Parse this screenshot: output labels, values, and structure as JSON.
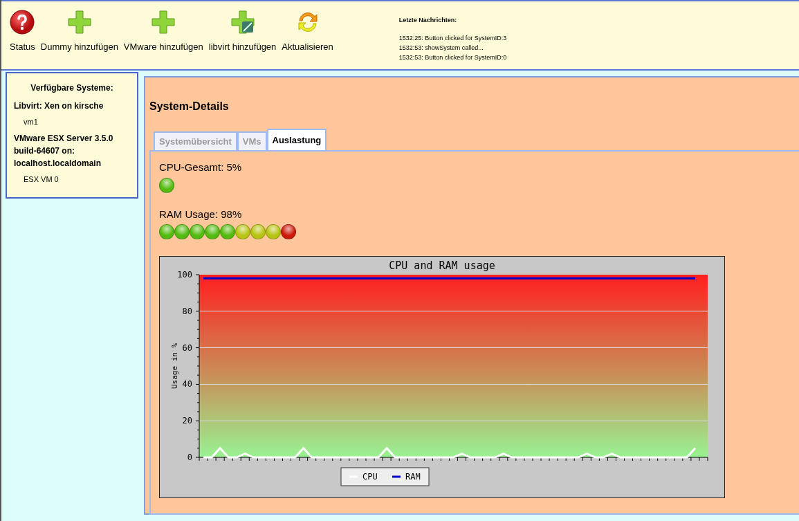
{
  "toolbar": {
    "buttons": [
      {
        "kind": "status",
        "label": "Status"
      },
      {
        "kind": "add",
        "label": "Dummy hinzufügen"
      },
      {
        "kind": "add",
        "label": "VMware hinzufügen"
      },
      {
        "kind": "add-libvirt",
        "label": "libvirt hinzufügen"
      },
      {
        "kind": "refresh",
        "label": "Aktualisieren"
      }
    ],
    "messages": {
      "title": "Letzte Nachrichten:",
      "lines": [
        "1532:25: Button clicked for SystemID:3",
        "1532:53: showSystem called...",
        "1532:53: Button clicked for SystemID:0"
      ]
    }
  },
  "sidebar": {
    "title": "Verfügbare Systeme:",
    "items": [
      {
        "label": "Libvirt: Xen on kirsche",
        "children": [
          {
            "label": "vm1"
          }
        ]
      },
      {
        "label": "VMware ESX Server 3.5.0 build-64607 on: localhost.localdomain",
        "children": [
          {
            "label": "ESX VM 0"
          }
        ]
      }
    ]
  },
  "details": {
    "title": "System-Details",
    "tabs": [
      {
        "label": "Systemübersicht",
        "selected": false
      },
      {
        "label": "VMs",
        "selected": false
      },
      {
        "label": "Auslastung",
        "selected": true
      }
    ],
    "meters": [
      {
        "label": "CPU-Gesamt: 5%",
        "dots": [
          {
            "color": "#55bb11"
          }
        ]
      },
      {
        "label": "RAM Usage: 98%",
        "dots": [
          {
            "color": "#55bb11"
          },
          {
            "color": "#55bb11"
          },
          {
            "color": "#55bb11"
          },
          {
            "color": "#55bb11"
          },
          {
            "color": "#55bb11"
          },
          {
            "color": "#b8c414"
          },
          {
            "color": "#b8c414"
          },
          {
            "color": "#b8c414"
          },
          {
            "color": "#cc1a0a"
          }
        ]
      }
    ],
    "chart_data": {
      "type": "line",
      "title": "CPU and RAM usage",
      "ylabel": "Usage in %",
      "ylim": [
        0,
        100
      ],
      "yticks": [
        0,
        20,
        40,
        60,
        80,
        100
      ],
      "grid": true,
      "legend": true,
      "series": [
        {
          "name": "CPU",
          "color": "#ffffff",
          "values": [
            0,
            0,
            5,
            0,
            0,
            2,
            0,
            0,
            0,
            0,
            0,
            0,
            5,
            0,
            0,
            0,
            0,
            0,
            0,
            0,
            0,
            0,
            5,
            0,
            0,
            0,
            0,
            0,
            0,
            0,
            0,
            2,
            0,
            0,
            0,
            0,
            2,
            0,
            0,
            0,
            0,
            0,
            0,
            0,
            0,
            0,
            2,
            0,
            0,
            2,
            0,
            0,
            0,
            0,
            0,
            0,
            0,
            0,
            0,
            5
          ]
        },
        {
          "name": "RAM",
          "color": "#0000cc",
          "values": [
            98,
            98,
            98,
            98,
            98,
            98,
            98,
            98,
            98,
            98,
            98,
            98,
            98,
            98,
            98,
            98,
            98,
            98,
            98,
            98,
            98,
            98,
            98,
            98,
            98,
            98,
            98,
            98,
            98,
            98,
            98,
            98,
            98,
            98,
            98,
            98,
            98,
            98,
            98,
            98,
            98,
            98,
            98,
            98,
            98,
            98,
            98,
            98,
            98,
            98,
            98,
            98,
            98,
            98,
            98,
            98,
            98,
            98,
            98,
            98
          ]
        }
      ]
    }
  }
}
